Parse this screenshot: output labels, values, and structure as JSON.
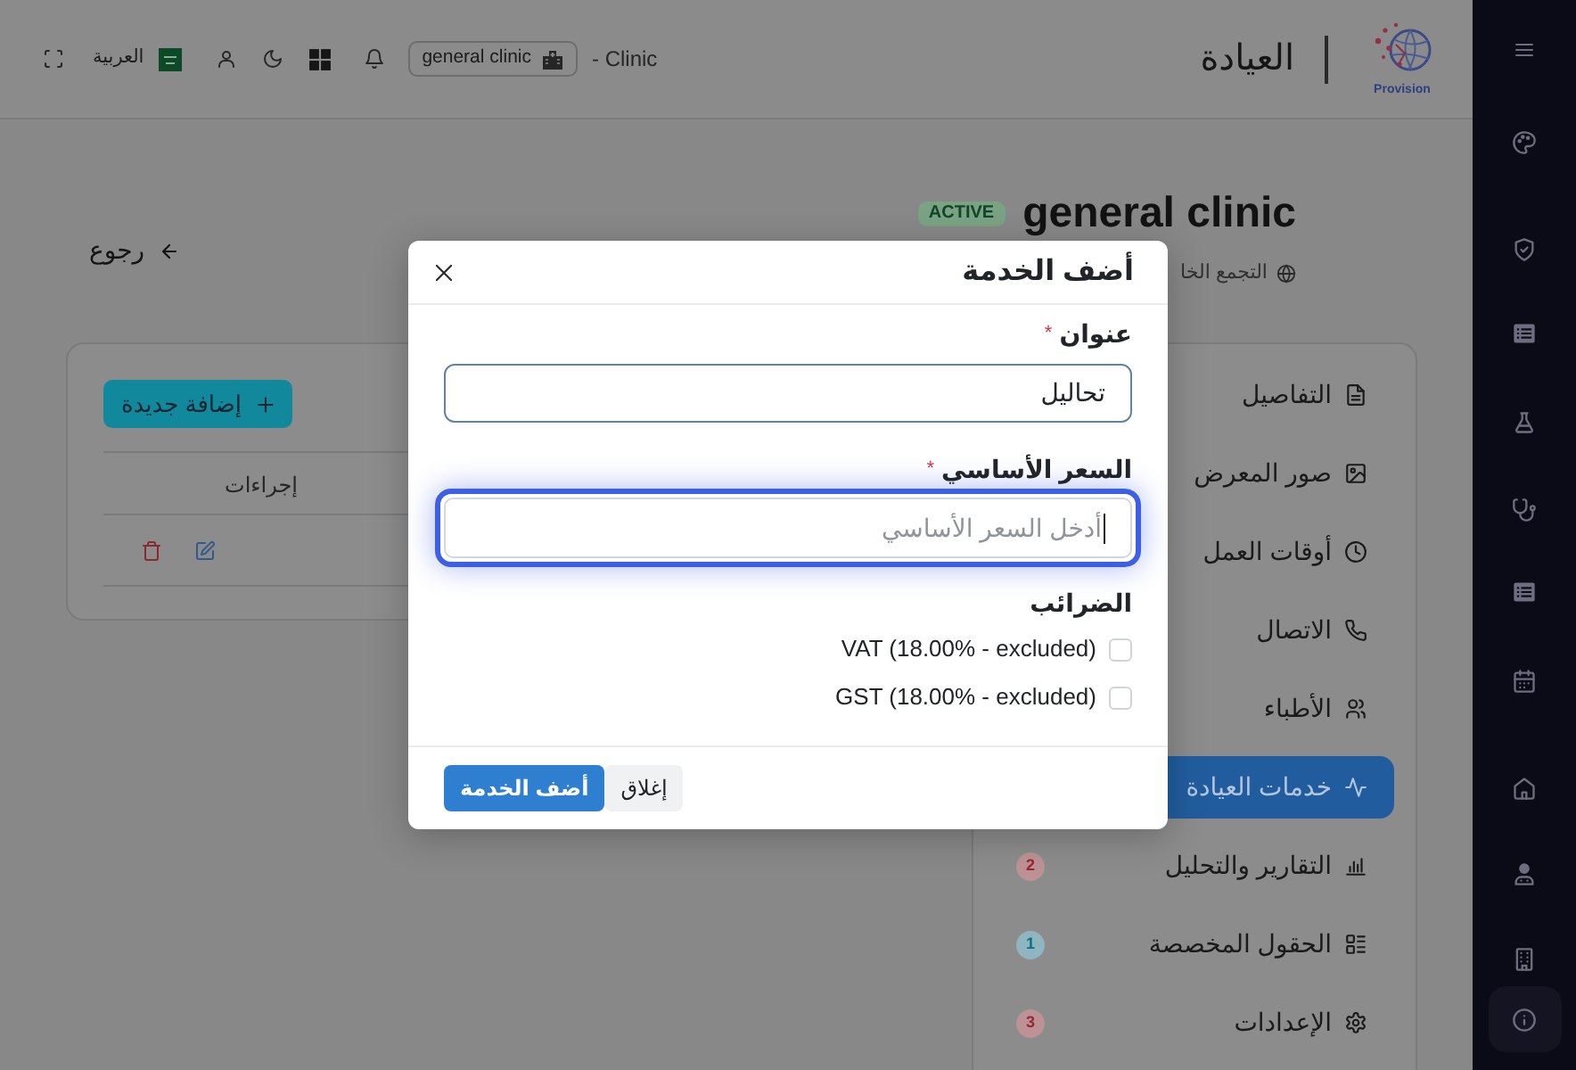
{
  "header": {
    "logo_text": "Provision",
    "title": "العيادة",
    "app_suffix": "- Clinic",
    "clinic_selector": "general clinic",
    "language": "العربية"
  },
  "page_title": {
    "name": "general clinic",
    "status": "ACTIVE",
    "subtitle": "التجمع الخا",
    "back_link": "رجوع"
  },
  "clinic_menu": {
    "items": [
      {
        "label": "التفاصيل",
        "selected": false
      },
      {
        "label": "صور المعرض",
        "selected": false
      },
      {
        "label": "أوقات العمل",
        "selected": false
      },
      {
        "label": "الاتصال",
        "selected": false
      },
      {
        "label": "الأطباء",
        "selected": false
      },
      {
        "label": "خدمات العيادة",
        "selected": true
      },
      {
        "label": "التقارير والتحليل",
        "selected": false,
        "badge": {
          "text": "2",
          "color": "#bd9296"
        }
      },
      {
        "label": "الحقول المخصصة",
        "selected": false,
        "badge": {
          "text": "1",
          "color": "#8fb6c0"
        }
      },
      {
        "label": "الإعدادات",
        "selected": false,
        "badge": {
          "text": "3",
          "color": "#bd9296"
        }
      }
    ]
  },
  "services_card": {
    "add_button": "إضافة جديدة",
    "columns": [
      "إجراءات"
    ],
    "rows": [
      {
        "kind": "actions"
      }
    ]
  },
  "modal": {
    "title": "أضف الخدمة",
    "fields": [
      {
        "label": "عنوان",
        "required_mark": "*",
        "value": "تحاليل",
        "focused": false
      },
      {
        "label": "السعر الأساسي",
        "required_mark": "*",
        "placeholder": "أدخل السعر الأساسي",
        "focused": true
      }
    ],
    "taxes": {
      "label": "الضرائب",
      "options": [
        {
          "label": "VAT (18.00% - excluded)",
          "checked": false
        },
        {
          "label": "GST (18.00% - excluded)",
          "checked": false
        }
      ]
    },
    "buttons": [
      {
        "label": "إغلاق",
        "kind": "secondary"
      },
      {
        "label": "أضف الخدمة",
        "kind": "primary"
      }
    ]
  }
}
